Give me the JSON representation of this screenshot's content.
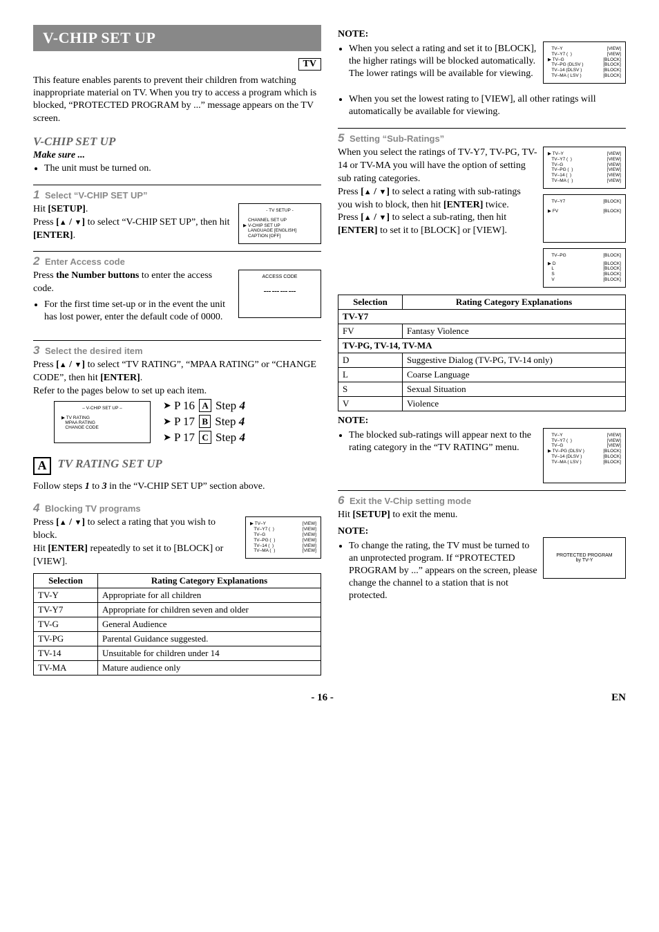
{
  "banner": "V-CHIP SET UP",
  "tv_badge": "TV",
  "intro": "This feature enables parents to prevent their children from watching inappropriate material on TV. When you try to access a program which is blocked, “PROTECTED PROGRAM by ...” message appears on the TV screen.",
  "heading_vchip": "V-CHIP SET UP",
  "make_sure": "Make sure ...",
  "make_sure_item": "The unit must be turned on.",
  "step1": {
    "num": "1",
    "title": "Select “V-CHIP SET UP”",
    "line1_a": "Hit ",
    "line1_b": "[SETUP]",
    "line1_c": ".",
    "line2_a": "Press ",
    "line2_b": "[",
    "line2_c": " / ",
    "line2_d": "]",
    "line2_e": " to select “V-CHIP SET UP”, then hit ",
    "line2_f": "[ENTER]",
    "line2_g": ".",
    "osd_title": "- TV SETUP -",
    "osd_items": [
      "CHANNEL SET UP",
      "V-CHIP SET UP",
      "LANGUAGE   [ENGLISH]",
      "CAPTION   [OFF]"
    ]
  },
  "step2": {
    "num": "2",
    "title": "Enter Access code",
    "line1_a": "Press ",
    "line1_b": "the Number buttons",
    "line1_c": " to enter the access code.",
    "bullet": "For the first time set-up or in the event the unit has lost power, enter the default code of 0000.",
    "osd_title": "ACCESS CODE"
  },
  "step3": {
    "num": "3",
    "title": "Select the desired item",
    "line1_a": "Press ",
    "line1_b": "[",
    "line1_c": " / ",
    "line1_d": "]",
    "line1_e": " to select “TV RATING”, “MPAA RATING” or “CHANGE CODE”, then hit ",
    "line1_f": "[ENTER]",
    "line1_g": ".",
    "line2": "Refer to the pages below to set up each item.",
    "osd_title": "– V-CHIP SET UP –",
    "osd_items": [
      "TV RATING",
      "MPAA RATING",
      "CHANGE CODE"
    ],
    "ref1_a": "P 16 ",
    "ref1_b": "A",
    "ref1_c": " Step ",
    "ref1_d": "4",
    "ref2_a": "P 17 ",
    "ref2_b": "B",
    "ref2_c": " Step ",
    "ref2_d": "4",
    "ref3_a": "P 17 ",
    "ref3_b": "C",
    "ref3_c": " Step ",
    "ref3_d": "4"
  },
  "sectA": {
    "letter": "A",
    "title": "TV RATING SET UP",
    "follow_a": "Follow steps ",
    "follow_b": "1",
    "follow_c": " to ",
    "follow_d": "3",
    "follow_e": " in the “V-CHIP SET UP” section above."
  },
  "step4": {
    "num": "4",
    "title": "Blocking TV programs",
    "l1a": "Press ",
    "l1b": "[",
    "l1c": " / ",
    "l1d": "]",
    "l1e": " to select a rating that you wish to block.",
    "l2a": "Hit ",
    "l2b": "[ENTER]",
    "l2c": " repeatedly to set it to [BLOCK] or [VIEW].",
    "osd_rows": [
      [
        "TV–Y",
        "",
        "[VIEW]"
      ],
      [
        "TV–Y7  (",
        "",
        "[VIEW]"
      ],
      [
        "TV–G",
        "",
        "[VIEW]"
      ],
      [
        "TV–PG (",
        "",
        "[VIEW]"
      ],
      [
        "TV–14  (",
        "",
        "[VIEW]"
      ],
      [
        "TV–MA (",
        "",
        "[VIEW]"
      ]
    ]
  },
  "rating_tbl1": {
    "h1": "Selection",
    "h2": "Rating Category Explanations",
    "rows": [
      [
        "TV-Y",
        "Appropriate for all children"
      ],
      [
        "TV-Y7",
        "Appropriate for children seven and older"
      ],
      [
        "TV-G",
        "General Audience"
      ],
      [
        "TV-PG",
        "Parental Guidance suggested."
      ],
      [
        "TV-14",
        "Unsuitable for children under 14"
      ],
      [
        "TV-MA",
        "Mature audience only"
      ]
    ]
  },
  "note_right1": {
    "hdr": "NOTE:",
    "b1": "When you select a rating and set it to [BLOCK], the higher ratings will be blocked automatically. The lower ratings will be available for viewing.",
    "b2": "When you set the lowest rating to [VIEW], all other ratings will automatically be available for viewing.",
    "osd_rows": [
      [
        "TV–Y",
        "",
        "[VIEW]"
      ],
      [
        "TV–Y7  (",
        "",
        "[VIEW]"
      ],
      [
        "TV–G",
        "",
        "[BLOCK]"
      ],
      [
        "TV–PG (DLSV )",
        "",
        "[BLOCK]"
      ],
      [
        "TV–14  (DLSV )",
        "",
        "[BLOCK]"
      ],
      [
        "TV–MA (  LSV )",
        "",
        "[BLOCK]"
      ]
    ]
  },
  "step5": {
    "num": "5",
    "title": "Setting “Sub-Ratings”",
    "p1": "When you select the ratings of TV-Y7, TV-PG, TV-14 or TV-MA you will have the option of setting sub rating categories.",
    "p2a": "Press ",
    "p2b": "[",
    "p2c": " / ",
    "p2d": "]",
    "p2e": " to select a rating with sub-ratings you wish to block, then hit ",
    "p2f": "[ENTER]",
    "p2g": " twice.",
    "p3a": "Press ",
    "p3b": "[",
    "p3c": " / ",
    "p3d": "]",
    "p3e": " to select a sub-rating, then hit ",
    "p3f": "[ENTER]",
    "p3g": " to set it to [BLOCK] or [VIEW].",
    "osd1": [
      [
        "TV–Y",
        "",
        "[VIEW]"
      ],
      [
        "TV–Y7  (",
        "",
        "[VIEW]"
      ],
      [
        "TV–G",
        "",
        "[VIEW]"
      ],
      [
        "TV–PG (",
        "",
        "[VIEW]"
      ],
      [
        "TV–14  (",
        "",
        "[VIEW]"
      ],
      [
        "TV–MA (",
        "",
        "[VIEW]"
      ]
    ],
    "osd2": [
      [
        "TV–Y7",
        "",
        "[BLOCK]"
      ],
      [
        "FV",
        "",
        "[BLOCK]"
      ]
    ],
    "osd3": [
      [
        "TV–PG",
        "",
        "[BLOCK]"
      ],
      [
        "D",
        "",
        "[BLOCK]"
      ],
      [
        "L",
        "",
        "[BLOCK]"
      ],
      [
        "S",
        "",
        "[BLOCK]"
      ],
      [
        "V",
        "",
        "[BLOCK]"
      ]
    ]
  },
  "rating_tbl2": {
    "h1": "Selection",
    "h2": "Rating Category Explanations",
    "grp1": "TV-Y7",
    "r1": [
      "FV",
      "Fantasy Violence"
    ],
    "grp2": "TV-PG, TV-14, TV-MA",
    "rows": [
      [
        "D",
        "Suggestive Dialog    (TV-PG, TV-14 only)"
      ],
      [
        "L",
        "Coarse Language"
      ],
      [
        "S",
        "Sexual Situation"
      ],
      [
        "V",
        "Violence"
      ]
    ]
  },
  "note_right2": {
    "hdr": "NOTE:",
    "b1": "The blocked sub-ratings will appear next to the rating category in the “TV RATING” menu.",
    "osd": [
      [
        "TV–Y",
        "",
        "[VIEW]"
      ],
      [
        "TV–Y7  (",
        "",
        "[VIEW]"
      ],
      [
        "TV–G",
        "",
        "[VIEW]"
      ],
      [
        "TV–PG (DLSV )",
        "",
        "[BLOCK]"
      ],
      [
        "TV–14  (DLSV )",
        "",
        "[BLOCK]"
      ],
      [
        "TV–MA (  LSV )",
        "",
        "[BLOCK]"
      ]
    ]
  },
  "step6": {
    "num": "6",
    "title": "Exit the V-Chip setting mode",
    "l1a": "Hit ",
    "l1b": "[SETUP]",
    "l1c": " to exit the menu.",
    "note_hdr": "NOTE:",
    "bullet": "To change the rating, the TV must be turned to an unprotected program. If “PROTECTED PROGRAM by ...” appears on the screen, please change the channel to a station that is not protected.",
    "protected_l1": "PROTECTED PROGRAM",
    "protected_l2": "by TV-Y"
  },
  "footer_page": "- 16 -",
  "footer_right": "EN"
}
